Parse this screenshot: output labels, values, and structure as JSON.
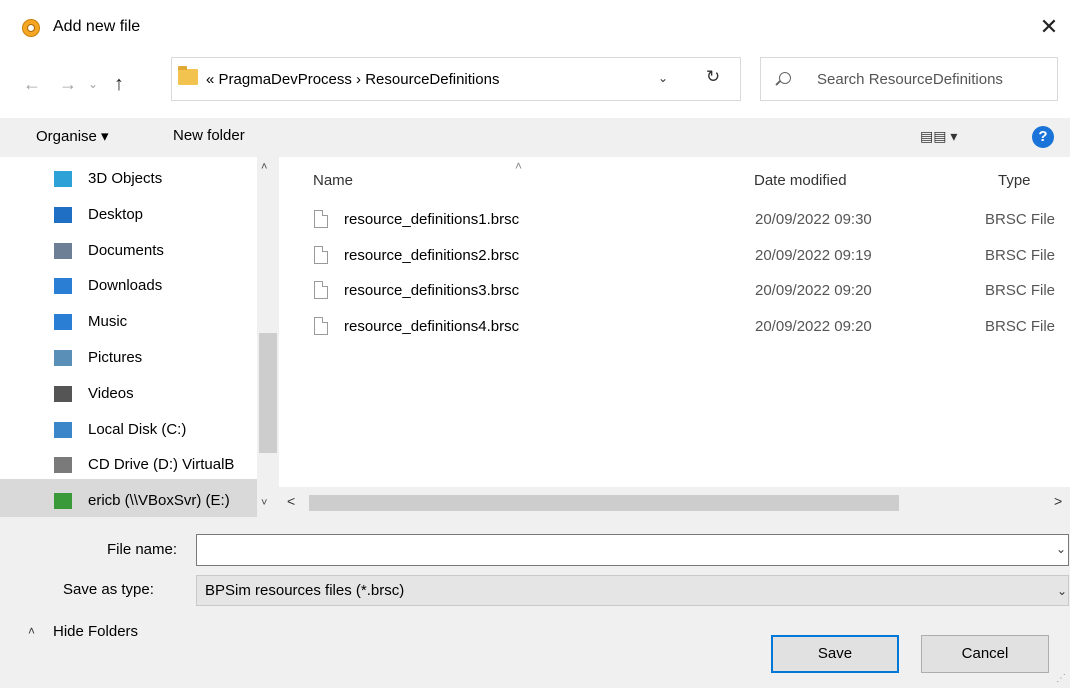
{
  "window": {
    "title": "Add new file",
    "close_glyph": "✕",
    "app_icon": "app-logo-icon"
  },
  "nav": {
    "back": "←",
    "forward": "→",
    "recent": "⌄",
    "up": "↑",
    "address_path": "«  PragmaDevProcess  ›  ResourceDefinitions",
    "address_dropdown": "⌄",
    "refresh": "↻",
    "search_placeholder": "Search ResourceDefinitions"
  },
  "toolbar": {
    "organise": "Organise ▾",
    "new_folder": "New folder",
    "view": "▤▤ ▾",
    "help": "?"
  },
  "sidebar": {
    "items": [
      {
        "label": "3D Objects",
        "icon": "3d-objects-icon",
        "color": "#2ea1d6"
      },
      {
        "label": "Desktop",
        "icon": "desktop-icon",
        "color": "#1f6fc4"
      },
      {
        "label": "Documents",
        "icon": "documents-icon",
        "color": "#6d7f94"
      },
      {
        "label": "Downloads",
        "icon": "downloads-icon",
        "color": "#2a7fd4"
      },
      {
        "label": "Music",
        "icon": "music-icon",
        "color": "#2a7fd4"
      },
      {
        "label": "Pictures",
        "icon": "pictures-icon",
        "color": "#5a8fb8"
      },
      {
        "label": "Videos",
        "icon": "videos-icon",
        "color": "#555555"
      },
      {
        "label": "Local Disk (C:)",
        "icon": "local-disk-icon",
        "color": "#3a86c8"
      },
      {
        "label": "CD Drive (D:) VirtualB",
        "icon": "cd-drive-icon",
        "color": "#7a7a7a"
      },
      {
        "label": "ericb (\\\\VBoxSvr) (E:)",
        "icon": "network-drive-icon",
        "color": "#3a9a3a"
      }
    ],
    "scroll_up": "˄",
    "scroll_down": "˅"
  },
  "files": {
    "columns": {
      "name": "Name",
      "date": "Date modified",
      "type": "Type"
    },
    "sort_arrow": "˄",
    "rows": [
      {
        "name": "resource_definitions1.brsc",
        "date": "20/09/2022 09:30",
        "type": "BRSC File"
      },
      {
        "name": "resource_definitions2.brsc",
        "date": "20/09/2022 09:19",
        "type": "BRSC File"
      },
      {
        "name": "resource_definitions3.brsc",
        "date": "20/09/2022 09:20",
        "type": "BRSC File"
      },
      {
        "name": "resource_definitions4.brsc",
        "date": "20/09/2022 09:20",
        "type": "BRSC File"
      }
    ],
    "hscroll_left": "<",
    "hscroll_right": ">"
  },
  "form": {
    "filename_label": "File name:",
    "filename_value": "",
    "savetype_label": "Save as type:",
    "savetype_value": "BPSim resources files (*.brsc)",
    "dropdown_glyph": "⌄",
    "hide_folders": "Hide Folders",
    "hide_chevron": "˄",
    "save": "Save",
    "cancel": "Cancel"
  },
  "colors": {
    "accent": "#0078d7",
    "help": "#1a73d9"
  }
}
